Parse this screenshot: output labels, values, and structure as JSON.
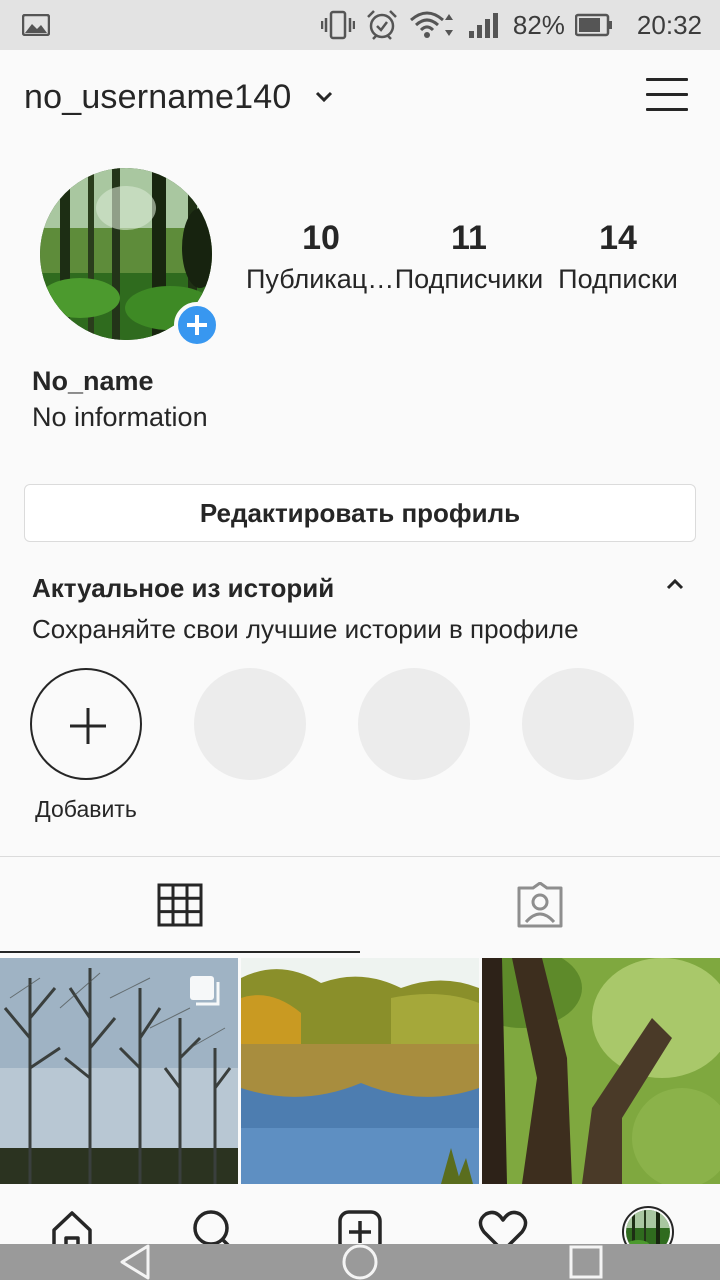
{
  "status_bar": {
    "battery_percent": "82%",
    "time": "20:32",
    "icons": [
      "gallery-icon",
      "vibrate-icon",
      "alarm-icon",
      "wifi-icon",
      "signal-icon",
      "battery-icon"
    ]
  },
  "header": {
    "username": "no_username140",
    "icons": [
      "chevron-down-icon",
      "menu-icon"
    ]
  },
  "profile": {
    "stats": [
      {
        "count": "10",
        "label": "Публикации"
      },
      {
        "count": "11",
        "label": "Подписчики"
      },
      {
        "count": "14",
        "label": "Подписки"
      }
    ],
    "name": "No_name",
    "bio": "No information",
    "edit_button": "Редактировать профиль"
  },
  "highlights": {
    "title": "Актуальное из историй",
    "subtitle": "Сохраняйте свои лучшие истории в профиле",
    "new_label": "Добавить",
    "placeholder_count": 3
  },
  "tabs": {
    "active": "grid",
    "items": [
      "grid-icon",
      "tagged-icon"
    ]
  },
  "posts": [
    {
      "name": "post-bare-trees",
      "multiple": true
    },
    {
      "name": "post-lake-autumn",
      "multiple": false
    },
    {
      "name": "post-tree-trunks",
      "multiple": false
    }
  ],
  "bottom_nav": {
    "items": [
      "home-icon",
      "search-icon",
      "new-post-icon",
      "activity-heart-icon",
      "profile-avatar"
    ]
  },
  "system_nav": {
    "items": [
      "back-icon",
      "home-circle-icon",
      "recents-icon"
    ]
  },
  "colors": {
    "accent": "#3897f0",
    "text": "#262626",
    "border": "#dbdbdb",
    "background": "#fafafa",
    "status_bar": "#e3e3e3",
    "system_nav": "#9a9a9a"
  }
}
